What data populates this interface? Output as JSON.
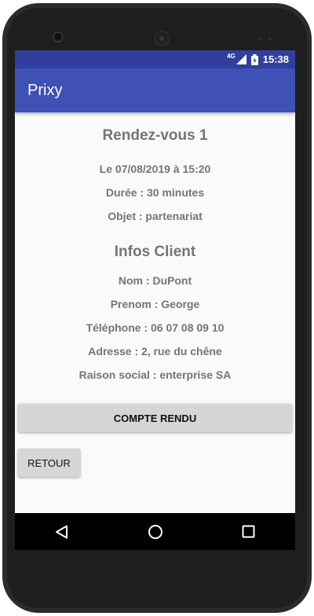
{
  "status_bar": {
    "network_label": "4G",
    "time": "15:38",
    "icons": [
      "signal-icon",
      "battery-icon"
    ]
  },
  "app_bar": {
    "title": "Prixy"
  },
  "rendezvous": {
    "title": "Rendez-vous 1",
    "date": "Le 07/08/2019 à 15:20",
    "duree": "Durée : 30 minutes",
    "objet": "Objet : partenariat"
  },
  "client": {
    "title": "Infos Client",
    "nom": "Nom :  DuPont",
    "prenom": "Prenom :  George",
    "telephone": "Téléphone : 06 07 08 09 10",
    "adresse": "Adresse : 2, rue du chêne",
    "raison_social": "Raison social : enterprise SA"
  },
  "buttons": {
    "compte_rendu": "COMPTE RENDU",
    "retour": "RETOUR"
  },
  "nav": {
    "icons": [
      "back-icon",
      "home-icon",
      "recents-icon"
    ]
  },
  "colors": {
    "status_bar": "#303f9f",
    "app_bar": "#3f51b5",
    "text": "#757575",
    "button": "#d6d6d6"
  }
}
